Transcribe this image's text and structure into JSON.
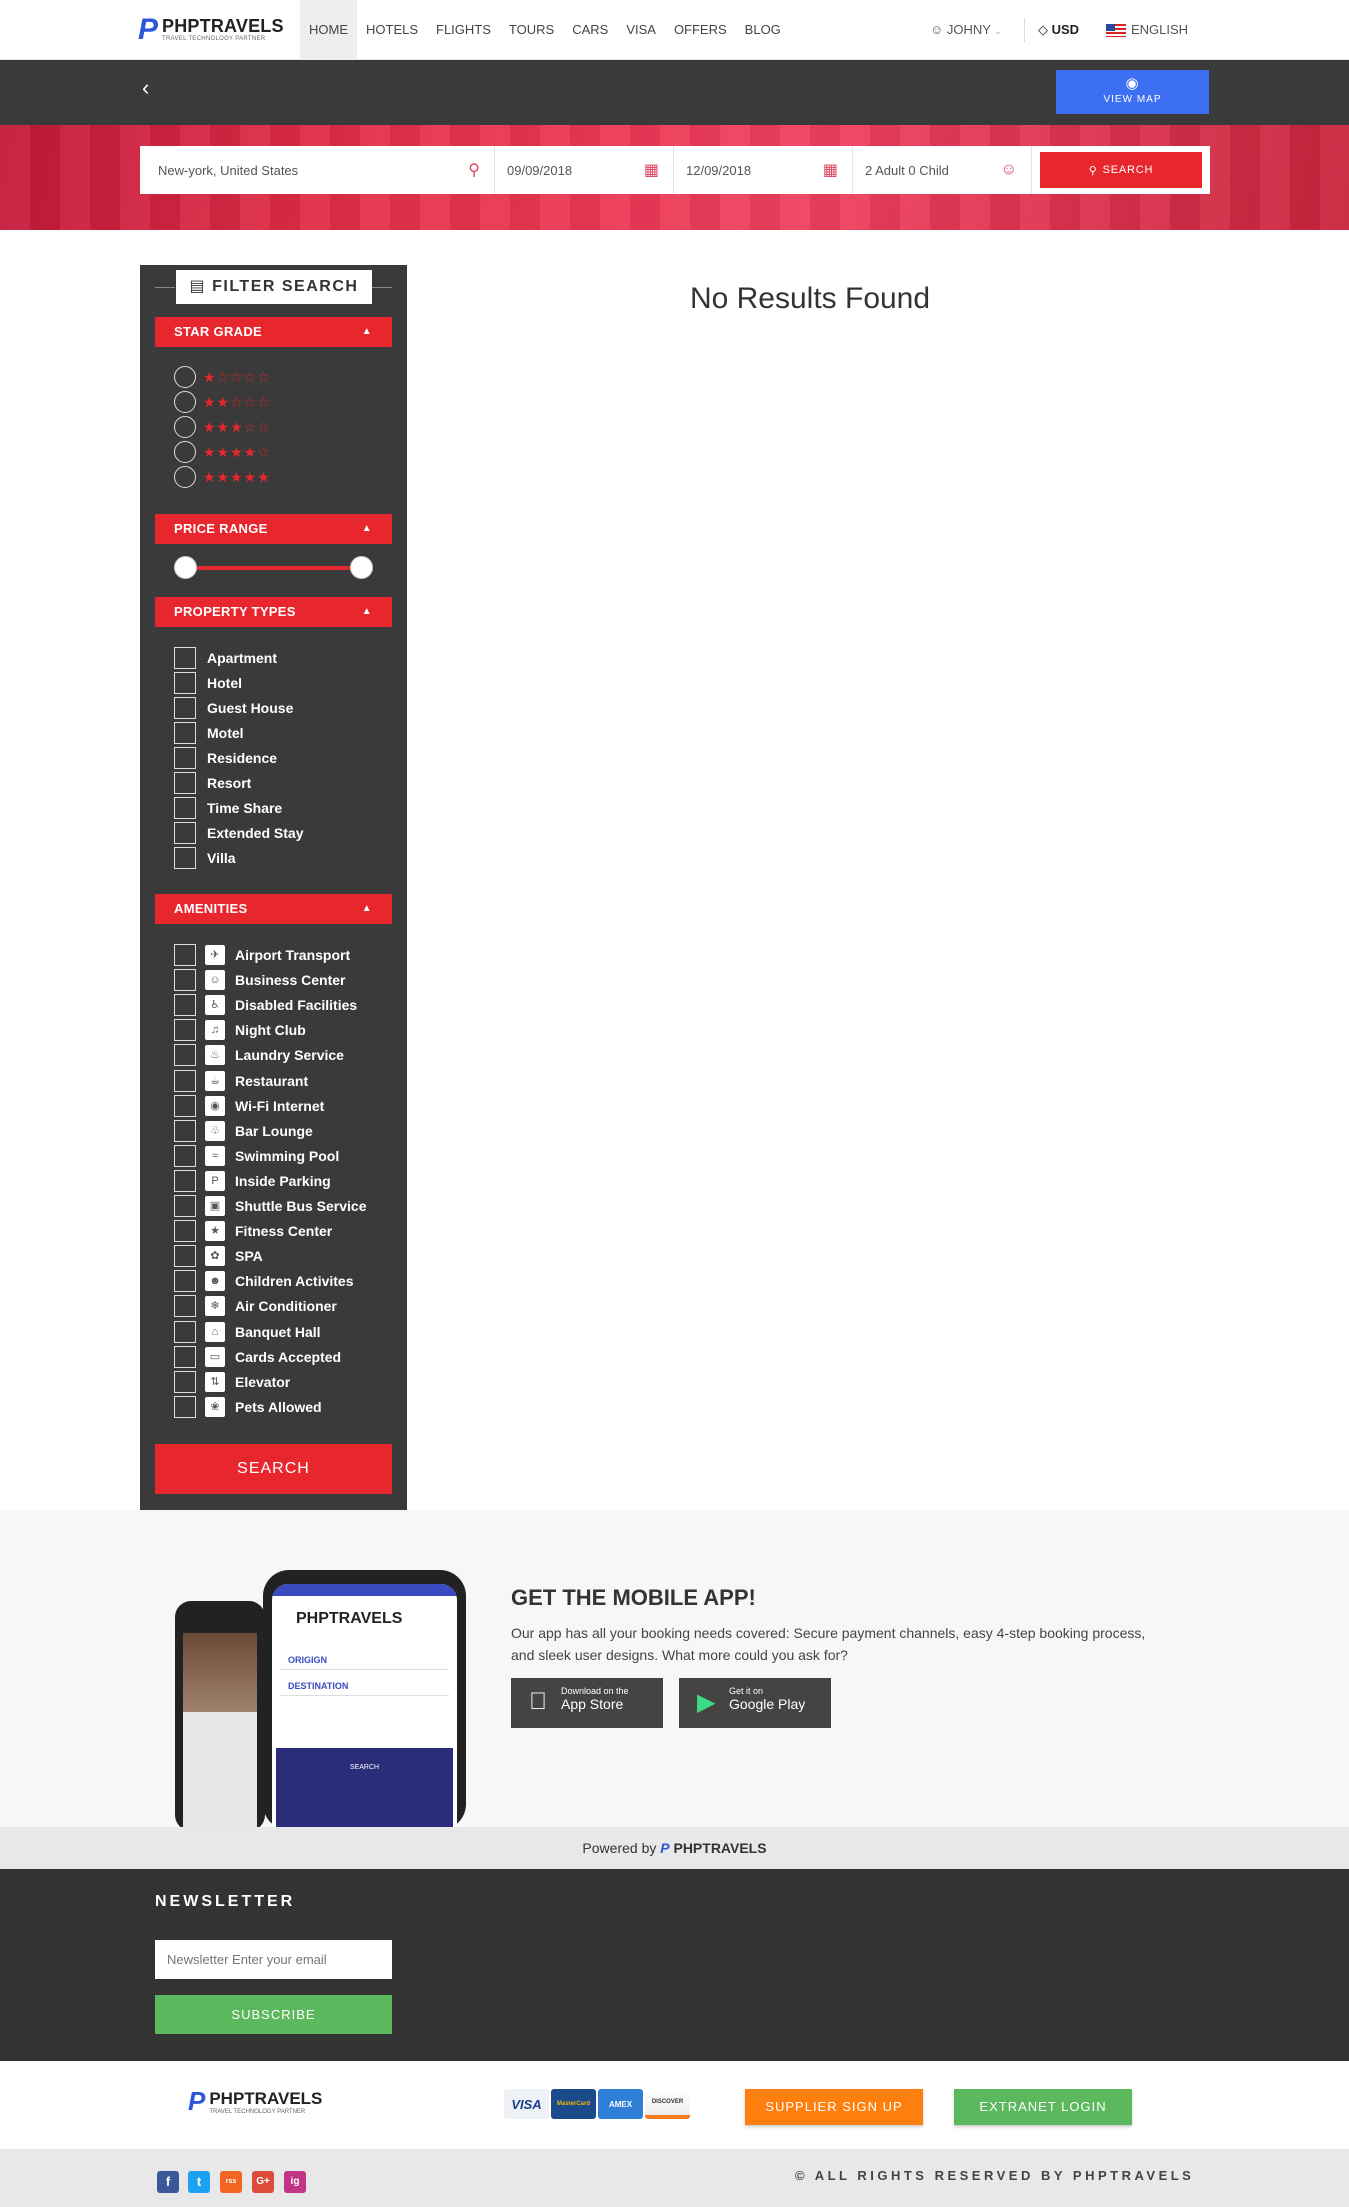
{
  "header": {
    "logo_title": "PHPTRAVELS",
    "logo_tagline": "TRAVEL TECHNOLOGY PARTNER",
    "nav": [
      "HOME",
      "HOTELS",
      "FLIGHTS",
      "TOURS",
      "CARS",
      "VISA",
      "OFFERS",
      "BLOG"
    ],
    "user": "JOHNY",
    "currency": "USD",
    "language": "ENGLISH"
  },
  "subbar": {
    "view_map": "VIEW MAP"
  },
  "search": {
    "location": "New-york, United States",
    "checkin": "09/09/2018",
    "checkout": "12/09/2018",
    "guests": "2 Adult 0 Child",
    "button": "SEARCH"
  },
  "filter": {
    "title": "FILTER SEARCH",
    "star_grade": "STAR GRADE",
    "star_levels": [
      1,
      2,
      3,
      4,
      5
    ],
    "price_range": "PRICE RANGE",
    "property_types_title": "PROPERTY TYPES",
    "property_types": [
      "Apartment",
      "Hotel",
      "Guest House",
      "Motel",
      "Residence",
      "Resort",
      "Time Share",
      "Extended Stay",
      "Villa"
    ],
    "amenities_title": "AMENITIES",
    "amenities": [
      "Airport Transport",
      "Business Center",
      "Disabled Facilities",
      "Night Club",
      "Laundry Service",
      "Restaurant",
      "Wi-Fi Internet",
      "Bar Lounge",
      "Swimming Pool",
      "Inside Parking",
      "Shuttle Bus Service",
      "Fitness Center",
      "SPA",
      "Children Activites",
      "Air Conditioner",
      "Banquet Hall",
      "Cards Accepted",
      "Elevator",
      "Pets Allowed"
    ],
    "search_button": "SEARCH"
  },
  "results": {
    "message": "No Results Found"
  },
  "mobile_app": {
    "heading": "GET THE MOBILE APP!",
    "text": "Our app has all your booking needs covered: Secure payment channels, easy 4-step booking process, and sleek user designs. What more could you ask for?",
    "appstore_small": "Download on the",
    "appstore_big": "App Store",
    "play_small": "Get it on",
    "play_big": "Google Play",
    "phone_origin": "ORIGIGN",
    "phone_destination": "DESTINATION",
    "phone_search": "SEARCH"
  },
  "powered": {
    "label": "Powered by",
    "brand": "PHPTRAVELS"
  },
  "newsletter": {
    "title": "NEWSLETTER",
    "placeholder": "Newsletter Enter your email",
    "button": "SUBSCRIBE"
  },
  "footer": {
    "cards": [
      "VISA",
      "MasterCard",
      "AMEX",
      "DISCOVER"
    ],
    "supplier": "SUPPLIER SIGN UP",
    "extranet": "EXTRANET LOGIN",
    "copyright": "© ALL RIGHTS RESERVED BY PHPTRAVELS",
    "social": [
      "f",
      "t",
      "rss",
      "G+",
      "ig"
    ]
  },
  "colors": {
    "accent": "#e8262d",
    "blue": "#3d6ff3",
    "green": "#5cb85c",
    "orange": "#ff7f0e",
    "dark": "#3a3a3a"
  }
}
